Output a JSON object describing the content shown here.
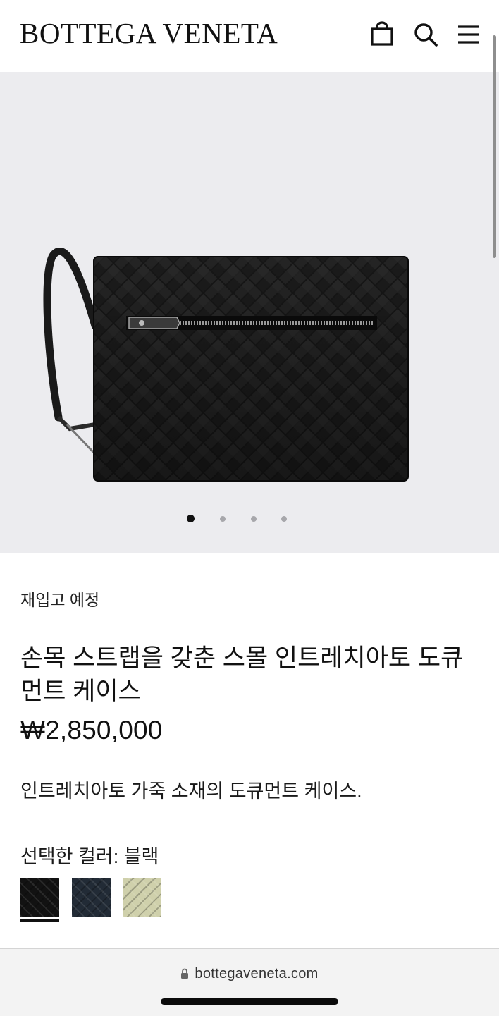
{
  "header": {
    "brand": "BOTTEGA VENETA",
    "icons": [
      "shopping-bag-icon",
      "search-icon",
      "menu-icon"
    ]
  },
  "gallery": {
    "image": "black intrecciato document case with wrist strap",
    "slide_count": 4,
    "active_slide": 1
  },
  "product": {
    "status": "재입고 예정",
    "title": "손목 스트랩을 갖춘 스몰 인트레치아토 도큐먼트 케이스",
    "price": "₩2,850,000",
    "description": "인트레치아토 가죽 소재의 도큐먼트 케이스.",
    "selected_color_label": "선택한 컬러: 블랙",
    "colors": [
      {
        "name": "블랙",
        "hex": "#121212",
        "selected": true
      },
      {
        "name": "navy",
        "hex": "#222b36",
        "selected": false
      },
      {
        "name": "sage",
        "hex": "#cfd0ab",
        "selected": false
      }
    ]
  },
  "browser": {
    "url": "bottegaveneta.com"
  }
}
